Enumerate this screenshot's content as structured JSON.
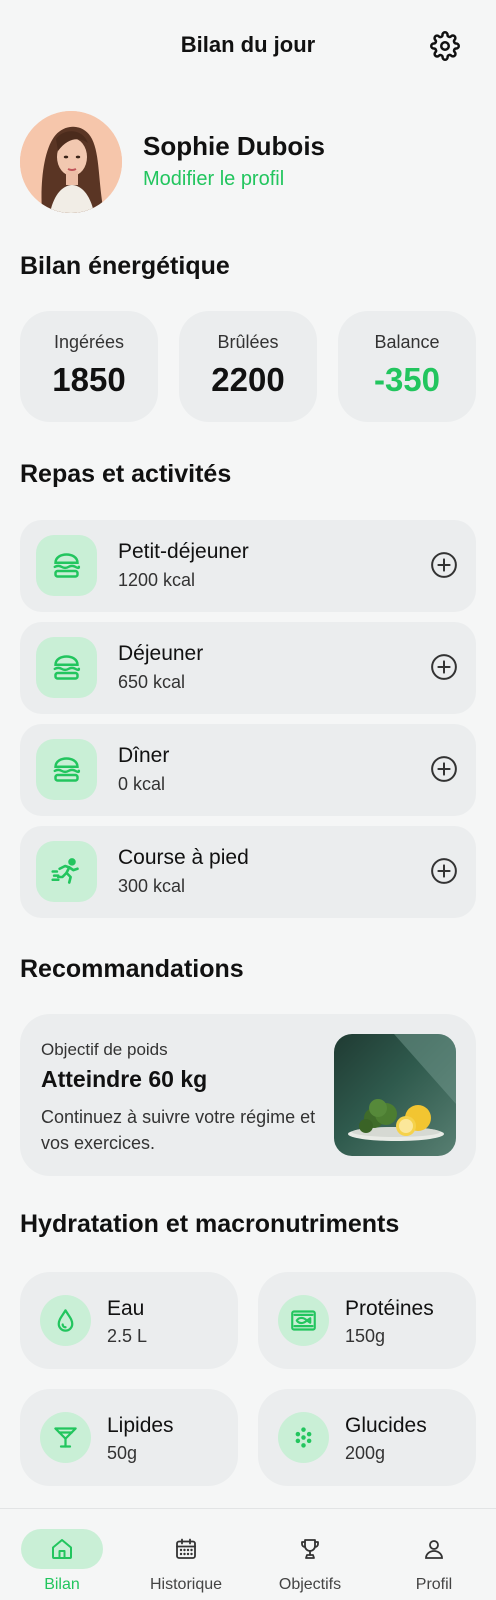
{
  "header": {
    "title": "Bilan du jour"
  },
  "profile": {
    "name": "Sophie Dubois",
    "edit_link": "Modifier le profil"
  },
  "energy": {
    "title": "Bilan énergétique",
    "stats": [
      {
        "label": "Ingérées",
        "value": "1850"
      },
      {
        "label": "Brûlées",
        "value": "2200"
      },
      {
        "label": "Balance",
        "value": "-350"
      }
    ]
  },
  "meals": {
    "title": "Repas et activités",
    "items": [
      {
        "title": "Petit-déjeuner",
        "sub": "1200 kcal",
        "icon": "burger-icon"
      },
      {
        "title": "Déjeuner",
        "sub": "650 kcal",
        "icon": "burger-icon"
      },
      {
        "title": "Dîner",
        "sub": "0 kcal",
        "icon": "burger-icon"
      },
      {
        "title": "Course à pied",
        "sub": "300 kcal",
        "icon": "running-icon"
      }
    ]
  },
  "recommendations": {
    "title": "Recommandations",
    "card": {
      "overline": "Objectif de poids",
      "title": "Atteindre 60 kg",
      "text": "Continuez à suivre votre régime et vos exercices."
    }
  },
  "macros": {
    "title": "Hydratation et macronutriments",
    "items": [
      {
        "title": "Eau",
        "sub": "2.5 L",
        "icon": "water-drop-icon"
      },
      {
        "title": "Protéines",
        "sub": "150g",
        "icon": "fish-icon"
      },
      {
        "title": "Lipides",
        "sub": "50g",
        "icon": "cocktail-icon"
      },
      {
        "title": "Glucides",
        "sub": "200g",
        "icon": "grain-icon"
      }
    ]
  },
  "tabs": [
    {
      "label": "Bilan",
      "icon": "home-icon",
      "active": true
    },
    {
      "label": "Historique",
      "icon": "calendar-icon",
      "active": false
    },
    {
      "label": "Objectifs",
      "icon": "trophy-icon",
      "active": false
    },
    {
      "label": "Profil",
      "icon": "user-icon",
      "active": false
    }
  ],
  "colors": {
    "accent": "#22c55e",
    "accent_soft": "#c9efd6",
    "card": "#ebedee",
    "background": "#f5f6f6"
  }
}
